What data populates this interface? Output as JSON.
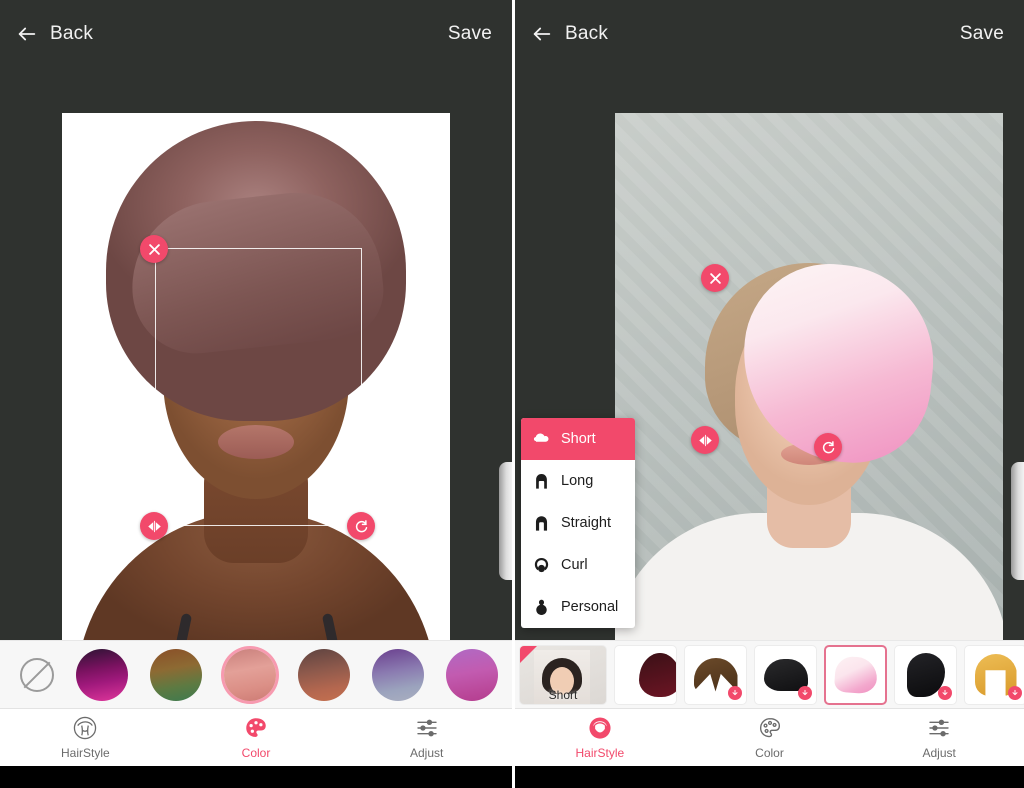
{
  "app": {
    "accent_pink": "#f2496b",
    "topbar_bg": "#2f322f",
    "strip_bg": "#f7f7f7"
  },
  "left_screen": {
    "topbar": {
      "back_label": "Back",
      "back_icon": "arrow-left-icon",
      "save_label": "Save"
    },
    "canvas": {
      "handles": {
        "close_icon": "close-x-icon",
        "flip_icon": "flip-horizontal-icon",
        "rotate_icon": "rotate-icon"
      },
      "pull_tab": "panel-pull-tab"
    },
    "color_strip": {
      "none_label": "no-color",
      "swatches": [
        {
          "name": "magenta-ombre",
          "top": "#2c1433",
          "mid": "#a0197c",
          "bottom": "#e0369b",
          "selected": false
        },
        {
          "name": "copper-green",
          "top": "#8a4f28",
          "mid": "#7c5c34",
          "bottom": "#3e7a4f",
          "selected": false
        },
        {
          "name": "rose-pink",
          "top": "#cf8784",
          "mid": "#e09a92",
          "bottom": "#d9867f",
          "selected": true
        },
        {
          "name": "auburn-brown",
          "top": "#6a4a46",
          "mid": "#a46253",
          "bottom": "#c06a4e",
          "selected": false
        },
        {
          "name": "lavender-violet",
          "top": "#6a3f8e",
          "mid": "#9183b5",
          "bottom": "#a9aec0",
          "selected": false
        },
        {
          "name": "orchid-purple",
          "top": "#b06ac4",
          "mid": "#c25bb0",
          "bottom": "#b43c8e",
          "selected": false
        },
        {
          "name": "crimson-red",
          "top": "#4e1522",
          "mid": "#a41f3c",
          "bottom": "#c83a58",
          "selected": false
        }
      ]
    },
    "bottom_nav": {
      "items": [
        {
          "label": "HairStyle",
          "icon": "hairstyle-icon",
          "active": false
        },
        {
          "label": "Color",
          "icon": "palette-icon",
          "active": true
        },
        {
          "label": "Adjust",
          "icon": "sliders-icon",
          "active": false
        }
      ]
    }
  },
  "right_screen": {
    "topbar": {
      "back_label": "Back",
      "back_icon": "arrow-left-icon",
      "save_label": "Save"
    },
    "canvas": {
      "handles": {
        "close_icon": "close-x-icon",
        "flip_icon": "flip-horizontal-icon",
        "rotate_icon": "rotate-icon"
      },
      "pull_tab": "panel-pull-tab"
    },
    "category_menu": {
      "items": [
        {
          "label": "Short",
          "icon": "short-hair-icon",
          "active": true
        },
        {
          "label": "Long",
          "icon": "long-hair-icon",
          "active": false
        },
        {
          "label": "Straight",
          "icon": "straight-hair-icon",
          "active": false
        },
        {
          "label": "Curl",
          "icon": "curl-hair-icon",
          "active": false
        },
        {
          "label": "Personal",
          "icon": "personal-hair-icon",
          "active": false
        }
      ]
    },
    "style_strip": {
      "category_card": {
        "label": "Short",
        "name": "category-card-short"
      },
      "thumbs": [
        {
          "name": "style-dark-burgundy",
          "color_top": "#3a1016",
          "color_bottom": "#6d1524",
          "shape": "bob",
          "download": false,
          "selected": false
        },
        {
          "name": "style-brown-parted",
          "color_top": "#6b4a2a",
          "color_bottom": "#4a3018",
          "shape": "parted",
          "download": true,
          "selected": false
        },
        {
          "name": "style-black-short",
          "color_top": "#2a2a2c",
          "color_bottom": "#101012",
          "shape": "pixie",
          "download": true,
          "selected": false
        },
        {
          "name": "style-pink-pixie",
          "color_top": "#fdf2f4",
          "color_bottom": "#ef8fc0",
          "shape": "swoop",
          "download": false,
          "selected": true
        },
        {
          "name": "style-black-long",
          "color_top": "#232327",
          "color_bottom": "#0b0b0d",
          "shape": "sidecut",
          "download": true,
          "selected": false
        },
        {
          "name": "style-blonde-bob",
          "color_top": "#e8b34a",
          "color_bottom": "#d99a2a",
          "shape": "bangbob",
          "download": true,
          "selected": false
        },
        {
          "name": "style-black-wave",
          "color_top": "#222226",
          "color_bottom": "#0a0a0c",
          "shape": "wave",
          "download": false,
          "selected": false
        }
      ],
      "more_icon": "chevron-left-icon"
    },
    "bottom_nav": {
      "items": [
        {
          "label": "HairStyle",
          "icon": "hairstyle-icon",
          "active": true
        },
        {
          "label": "Color",
          "icon": "palette-icon",
          "active": false
        },
        {
          "label": "Adjust",
          "icon": "sliders-icon",
          "active": false
        }
      ]
    }
  }
}
